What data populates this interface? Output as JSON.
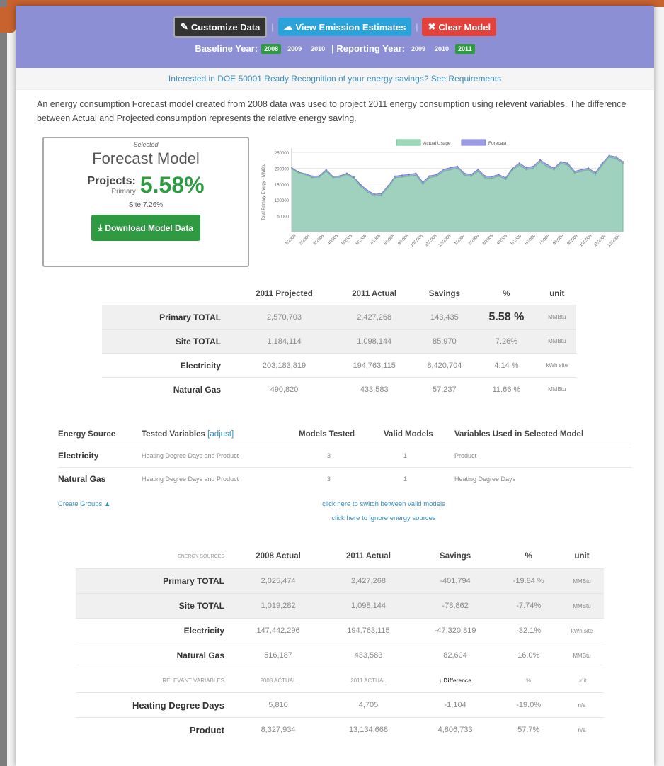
{
  "header": {
    "customize_label": "Customize Data",
    "emission_label": "View Emission Estimates",
    "clear_label": "Clear Model",
    "baseline_label": "Baseline Year:",
    "reporting_label": "| Reporting Year:",
    "baseline_years": [
      "2008",
      "2009",
      "2010"
    ],
    "baseline_selected": "2008",
    "reporting_years": [
      "2009",
      "2010",
      "2011"
    ],
    "reporting_selected": "2011"
  },
  "notice": "Interested in DOE 50001 Ready Recognition of your energy savings? See Requirements",
  "description": "An energy consumption Forecast model created from 2008 data was used to project 2011 energy consumption using relevent variables. The difference between Actual and Projected consumption represents the relative energy saving.",
  "forecast": {
    "selected": "Selected",
    "title": "Forecast Model",
    "projects_label": "Projects:",
    "primary_label": "Primary",
    "primary_pct": "5.58%",
    "site_line": "Site  7.26%",
    "download_label": "Download Model Data"
  },
  "chart_data": {
    "type": "area",
    "ylabel": "Total Primary Energy - MMBtu",
    "ylim": [
      0,
      250000
    ],
    "yticks": [
      "250000",
      "200000",
      "150000",
      "100000",
      "50000"
    ],
    "x_ticks": [
      "1/2008",
      "2/2008",
      "3/2008",
      "4/2008",
      "5/2008",
      "6/2008",
      "7/2008",
      "8/2008",
      "9/2008",
      "10/2008",
      "11/2008",
      "12/2008",
      "1/2009",
      "2/2009",
      "3/2009",
      "4/2009",
      "5/2009",
      "6/2009",
      "7/2009",
      "8/2009",
      "9/2009",
      "10/2009",
      "11/2009",
      "12/2009"
    ],
    "legend": "top",
    "colors": {
      "actual": "#9fd8b8",
      "forecast": "#9a9be0"
    },
    "series": [
      {
        "name": "Actual Usage",
        "values": [
          198000,
          185000,
          180000,
          170000,
          172000,
          190000,
          170000,
          172000,
          180000,
          168000,
          142000,
          125000,
          112000,
          115000,
          140000,
          170000,
          172000,
          175000,
          178000,
          150000,
          170000,
          175000,
          190000,
          195000,
          200000,
          178000,
          175000,
          190000,
          170000,
          168000,
          175000,
          165000,
          195000,
          210000,
          195000,
          200000,
          220000,
          205000,
          195000,
          215000,
          210000,
          185000,
          190000,
          195000,
          180000,
          210000,
          235000,
          230000,
          215000
        ]
      },
      {
        "name": "Forecast",
        "values": [
          202000,
          188000,
          182000,
          175000,
          176000,
          195000,
          174000,
          176000,
          184000,
          172000,
          148000,
          130000,
          118000,
          120000,
          145000,
          175000,
          178000,
          180000,
          184000,
          156000,
          176000,
          180000,
          196000,
          202000,
          206000,
          184000,
          180000,
          196000,
          176000,
          174000,
          180000,
          170000,
          200000,
          216000,
          202000,
          206000,
          226000,
          212000,
          200000,
          220000,
          216000,
          190000,
          196000,
          200000,
          186000,
          216000,
          240000,
          236000,
          220000
        ]
      }
    ]
  },
  "table1": {
    "headers": [
      "",
      "2011 Projected",
      "2011 Actual",
      "Savings",
      "%",
      "unit"
    ],
    "rows": [
      {
        "label": "Primary TOTAL",
        "projected": "2,570,703",
        "actual": "2,427,268",
        "savings": "143,435",
        "pct": "5.58 %",
        "unit": "MMBtu"
      },
      {
        "label": "Site TOTAL",
        "projected": "1,184,114",
        "actual": "1,098,144",
        "savings": "85,970",
        "pct": "7.26%",
        "unit": "MMBtu"
      },
      {
        "label": "Electricity",
        "projected": "203,183,819",
        "actual": "194,763,115",
        "savings": "8,420,704",
        "pct": "4.14 %",
        "unit": "kWh site"
      },
      {
        "label": "Natural Gas",
        "projected": "490,820",
        "actual": "433,583",
        "savings": "57,237",
        "pct": "11.66 %",
        "unit": "MMBtu"
      }
    ]
  },
  "table2": {
    "headers": {
      "source": "Energy Source",
      "tested": "Tested Variables",
      "adjust": "[adjust]",
      "models": "Models Tested",
      "valid": "Valid Models",
      "used": "Variables Used in Selected Model"
    },
    "rows": [
      {
        "source": "Electricity",
        "tested": "Heating Degree Days and Product",
        "models": "3",
        "valid": "1",
        "used": "Product"
      },
      {
        "source": "Natural Gas",
        "tested": "Heating Degree Days and Product",
        "models": "3",
        "valid": "1",
        "used": "Heating Degree Days"
      }
    ]
  },
  "links": {
    "create_groups": "Create Groups",
    "switch_models": "click here to switch between valid models",
    "ignore_sources": "click here to ignore energy sources"
  },
  "table3": {
    "headers": [
      "ENERGY SOURCES",
      "2008 Actual",
      "2011 Actual",
      "Savings",
      "%",
      "unit"
    ],
    "rows": [
      {
        "label": "Primary TOTAL",
        "base": "2,025,474",
        "actual": "2,427,268",
        "savings": "-401,794",
        "pct": "-19.84 %",
        "unit": "MMBtu"
      },
      {
        "label": "Site TOTAL",
        "base": "1,019,282",
        "actual": "1,098,144",
        "savings": "-78,862",
        "pct": "-7.74%",
        "unit": "MMBtu"
      },
      {
        "label": "Electricity",
        "base": "147,442,296",
        "actual": "194,763,115",
        "savings": "-47,320,819",
        "pct": "-32.1%",
        "unit": "kWh site"
      },
      {
        "label": "Natural Gas",
        "base": "516,187",
        "actual": "433,583",
        "savings": "82,604",
        "pct": "16.0%",
        "unit": "MMBtu"
      }
    ],
    "var_headers": [
      "RELEVANT VARIABLES",
      "2008 ACTUAL",
      "2011 ACTUAL",
      "Difference",
      "%",
      "unit"
    ],
    "var_rows": [
      {
        "label": "Heating Degree Days",
        "base": "5,810",
        "actual": "4,705",
        "diff": "-1,104",
        "pct": "-19.0%",
        "unit": "n/a"
      },
      {
        "label": "Product",
        "base": "8,327,934",
        "actual": "13,134,668",
        "diff": "4,806,733",
        "pct": "57.7%",
        "unit": "n/a"
      }
    ]
  }
}
